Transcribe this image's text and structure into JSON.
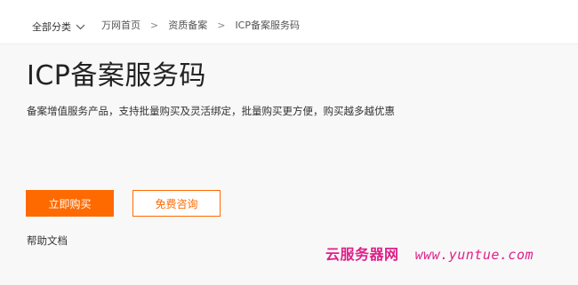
{
  "header": {
    "category_label": "全部分类",
    "breadcrumb": [
      {
        "label": "万网首页"
      },
      {
        "label": "资质备案"
      },
      {
        "label": "ICP备案服务码"
      }
    ],
    "breadcrumb_separator": ">"
  },
  "main": {
    "title": "ICP备案服务码",
    "subtitle": "备案增值服务产品，支持批量购买及灵活绑定，批量购买更方便，购买越多越优惠",
    "buy_button_label": "立即购买",
    "consult_button_label": "免费咨询",
    "help_link_label": "帮助文档"
  },
  "watermark": {
    "site_name": "云服务器网",
    "url": "www.yuntue.com"
  },
  "colors": {
    "accent": "#ff6a00",
    "watermark": "#e0208a",
    "background": "#f8f8f8"
  },
  "icons": {
    "dropdown": "chevron-down-icon"
  }
}
